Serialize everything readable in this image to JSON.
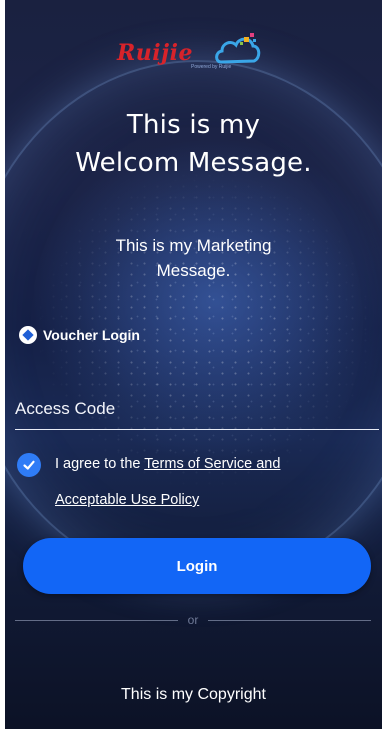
{
  "logo": {
    "brand": "Ruijie",
    "tagline": "Powered by Ruijie"
  },
  "welcome": {
    "line1": "This is my",
    "line2": "Welcom Message."
  },
  "marketing": {
    "line1": "This is my Marketing",
    "line2": "Message."
  },
  "voucher": {
    "label": "Voucher Login",
    "icon": "voucher-icon"
  },
  "access_code": {
    "placeholder": "Access Code",
    "value": ""
  },
  "agreement": {
    "checked": true,
    "prefix": "I agree to the ",
    "link1": "Terms of Service and",
    "link2": "Acceptable Use Policy"
  },
  "login": {
    "label": "Login"
  },
  "divider": {
    "label": "or"
  },
  "footer": {
    "copyright": "This is my Copyright"
  },
  "colors": {
    "accent": "#1266f6",
    "checkbox": "#2f7cf6",
    "brand_red": "#d8232a"
  }
}
